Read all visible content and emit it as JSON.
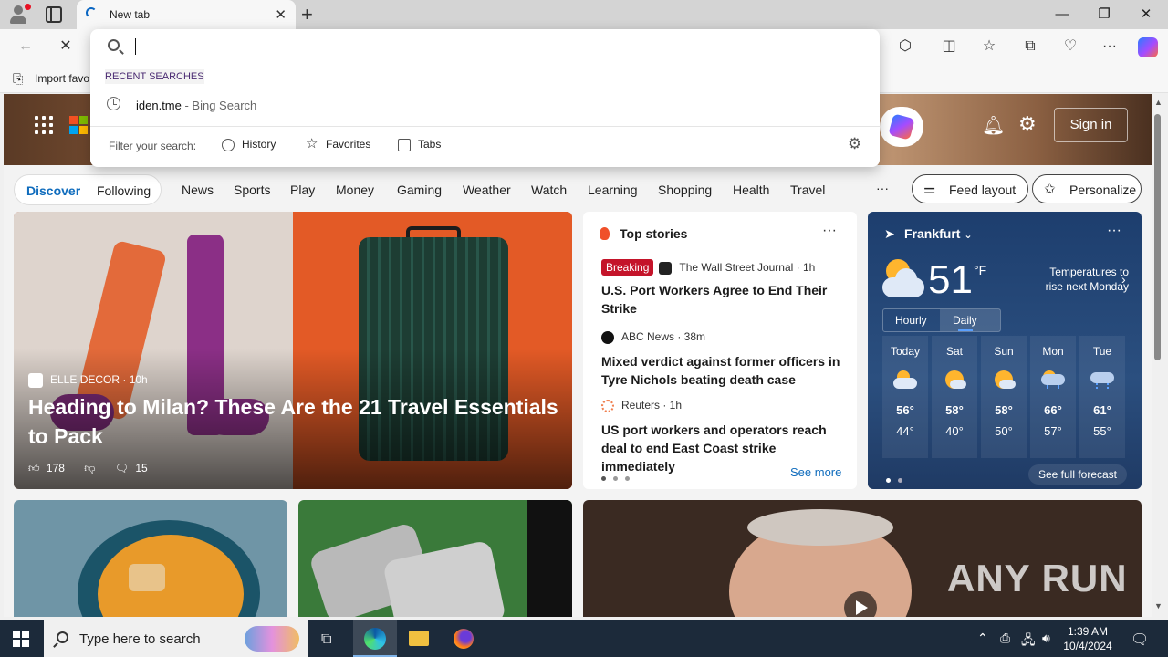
{
  "browser": {
    "tab_title": "New tab",
    "favorites_bar_item": "Import favo"
  },
  "omnibox": {
    "recent_label": "RECENT SEARCHES",
    "recent_query": "iden.tme",
    "recent_suffix": " - Bing Search",
    "filter_label": "Filter your search:",
    "chips": [
      "History",
      "Favorites",
      "Tabs"
    ]
  },
  "msn": {
    "sign_in": "Sign in",
    "segments": [
      "Discover",
      "Following"
    ],
    "nav": [
      "News",
      "Sports",
      "Play",
      "Money",
      "Gaming",
      "Weather",
      "Watch",
      "Learning",
      "Shopping",
      "Health",
      "Travel"
    ],
    "more": "···",
    "feed_layout": "Feed layout",
    "personalize": "Personalize"
  },
  "main_story": {
    "source": "ELLE DECOR",
    "age": "10h",
    "headline": "Heading to Milan? These Are the 21 Travel Essentials to Pack",
    "likes": "178",
    "comments": "15"
  },
  "top_stories": {
    "title": "Top stories",
    "see_more": "See more",
    "items": [
      {
        "badge": "Breaking",
        "source": "The Wall Street Journal · 1h",
        "logo_text": "WSJ",
        "headline": "U.S. Port Workers Agree to End Their Strike",
        "color": "#222222"
      },
      {
        "badge": "",
        "source": "ABC News · 38m",
        "logo_text": "",
        "headline": "Mixed verdict against former officers in Tyre Nichols beating death case",
        "color": "#111111"
      },
      {
        "badge": "",
        "source": "Reuters · 1h",
        "logo_text": "",
        "headline": "US port workers and operators reach deal to end East Coast strike immediately",
        "color": "#f08050"
      }
    ]
  },
  "weather": {
    "city": "Frankfurt",
    "temp": "51",
    "unit": "°F",
    "alert": "Temperatures to rise next Monday",
    "tabs": [
      "Hourly",
      "Daily"
    ],
    "forecast": [
      {
        "day": "Today",
        "hi": "56°",
        "lo": "44°",
        "icon": "cloudy-icon"
      },
      {
        "day": "Sat",
        "hi": "58°",
        "lo": "40°",
        "icon": "partly-sunny-icon"
      },
      {
        "day": "Sun",
        "hi": "58°",
        "lo": "50°",
        "icon": "partly-sunny-icon"
      },
      {
        "day": "Mon",
        "hi": "66°",
        "lo": "57°",
        "icon": "rain-icon"
      },
      {
        "day": "Tue",
        "hi": "61°",
        "lo": "55°",
        "icon": "rain-icon"
      }
    ],
    "see_full": "See full forecast"
  },
  "watermark": "ANY RUN",
  "taskbar": {
    "search_placeholder": "Type here to search",
    "time": "1:39 AM",
    "date": "10/4/2024"
  }
}
